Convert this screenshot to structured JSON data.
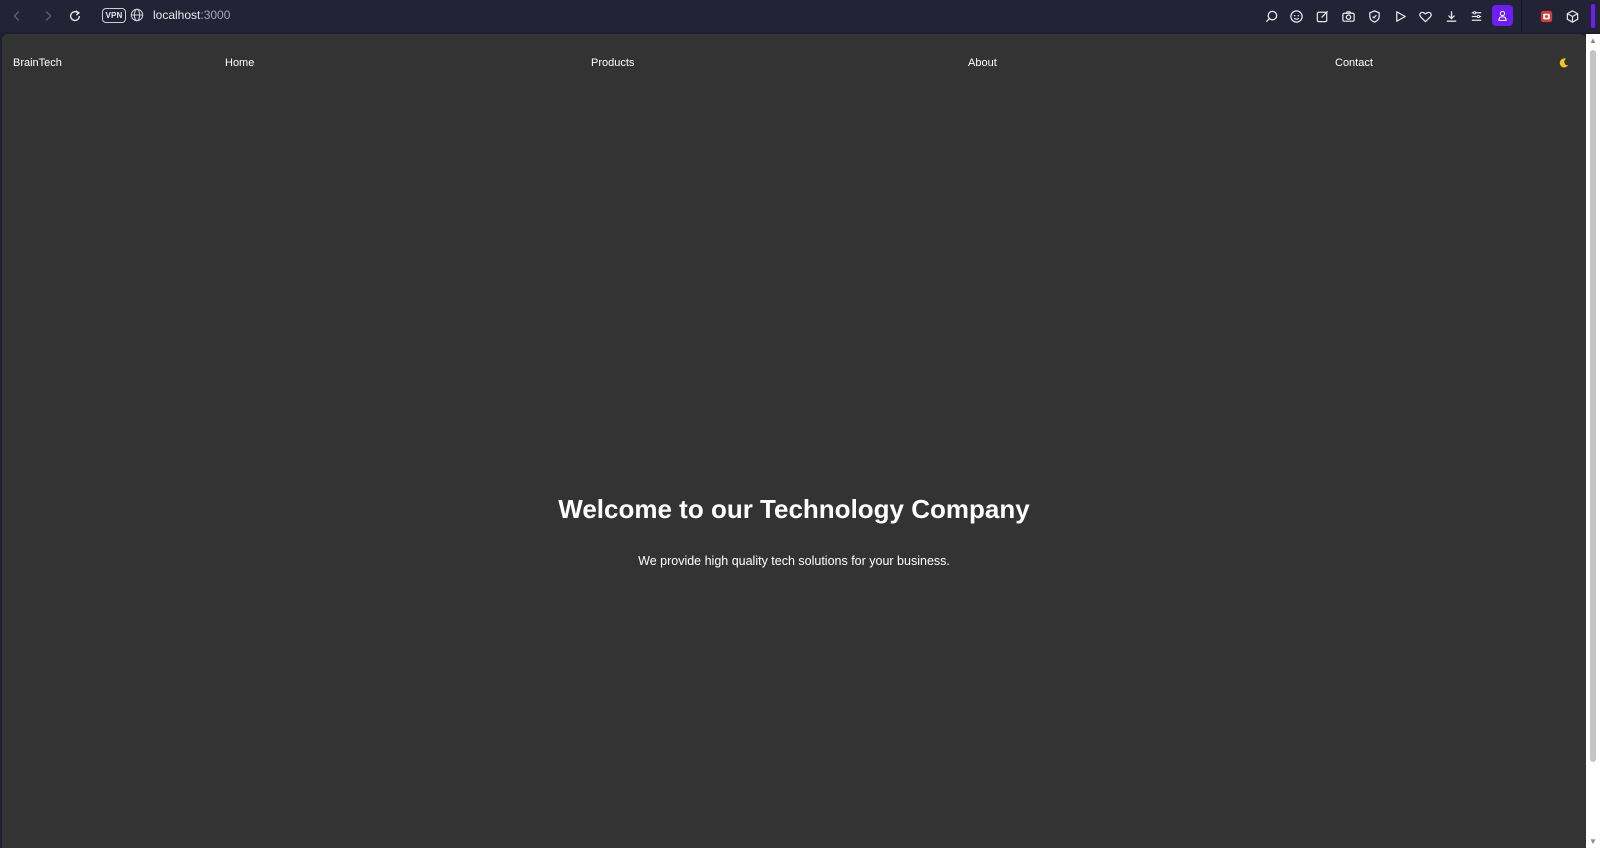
{
  "browser": {
    "vpn_label": "VPN",
    "url_host": "localhost",
    "url_port": ":3000"
  },
  "toolbar_icons": [
    "search-icon",
    "emoji-icon",
    "edit-icon",
    "camera-icon",
    "shield-icon",
    "send-icon",
    "heart-icon",
    "download-icon",
    "menu-icon",
    "profile-icon",
    "extension-icon",
    "cube-icon"
  ],
  "site": {
    "logo": "BrainTech",
    "nav": {
      "home": "Home",
      "products": "Products",
      "about": "About",
      "contact": "Contact"
    },
    "theme_icon": "moon-icon"
  },
  "hero": {
    "title": "Welcome to our Technology Company",
    "subtitle": "We provide high quality tech solutions for your business."
  },
  "colors": {
    "browser_chrome": "#222436",
    "page_background": "#333333",
    "text": "#ffffff",
    "accent": "#6b1ff5",
    "moon": "#f5c518"
  }
}
